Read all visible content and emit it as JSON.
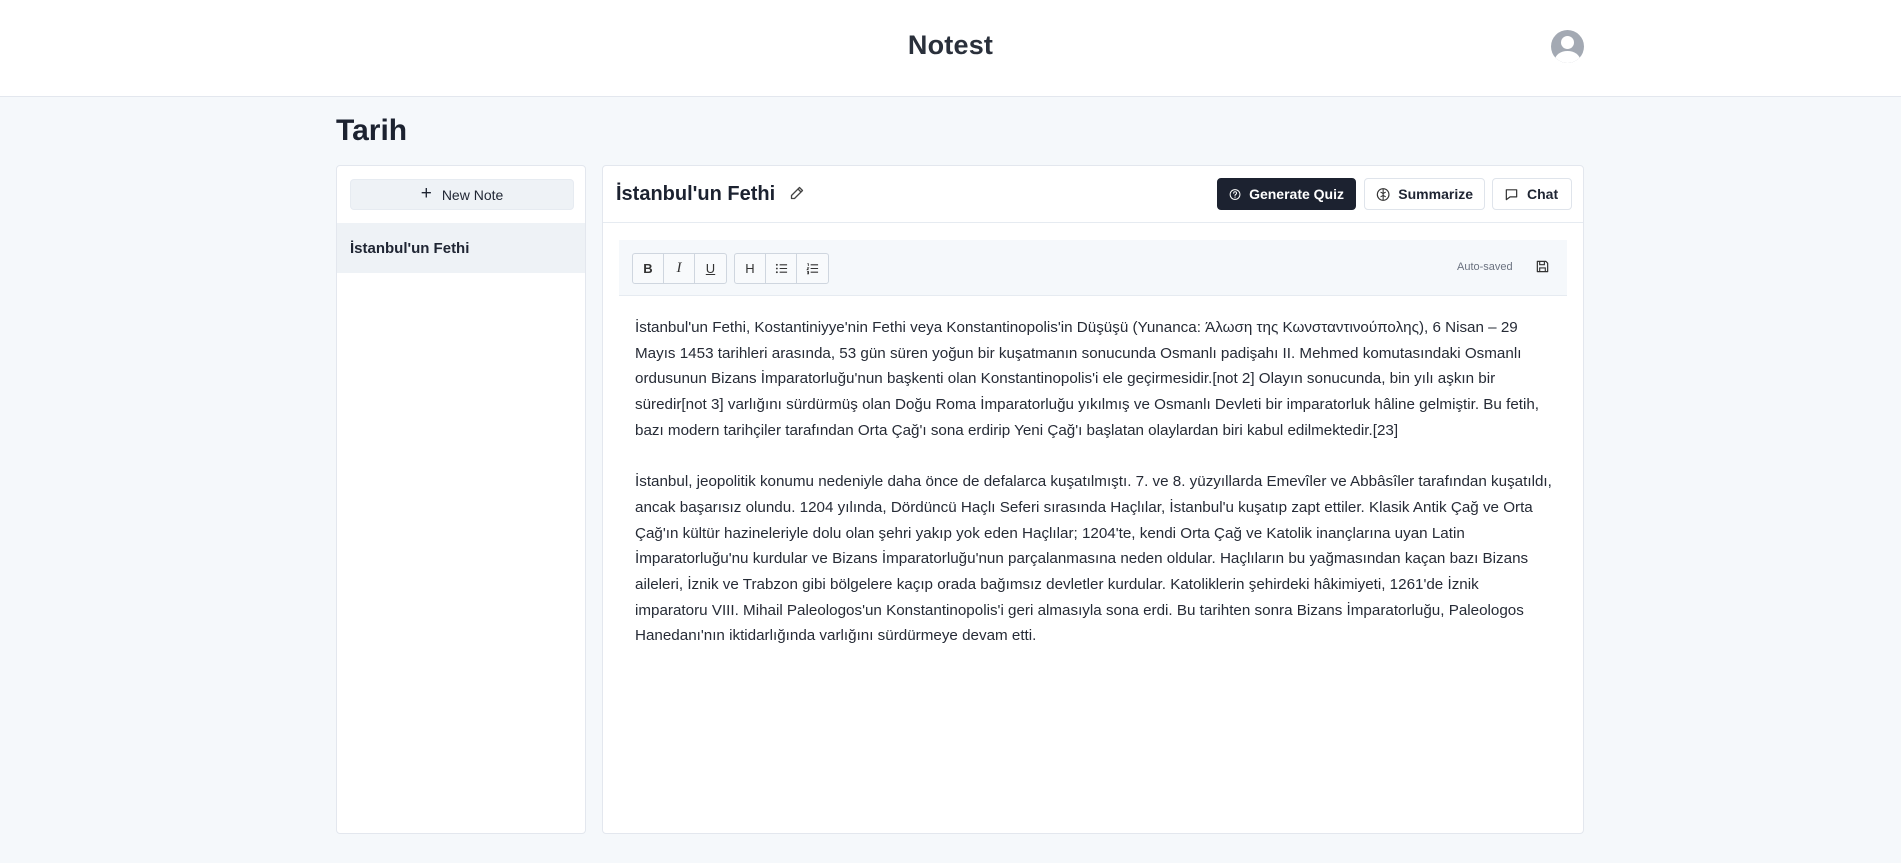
{
  "header": {
    "app_title": "Notest",
    "avatar_icon": "user-circle-icon"
  },
  "page": {
    "title": "Tarih"
  },
  "sidebar": {
    "new_note_label": "New Note",
    "new_note_icon": "plus-icon",
    "notes": [
      {
        "title": "İstanbul'un Fethi",
        "selected": true
      }
    ]
  },
  "note": {
    "title": "İstanbul'un Fethi",
    "actions": {
      "generate_quiz": "Generate Quiz",
      "summarize": "Summarize",
      "chat": "Chat"
    }
  },
  "editor": {
    "toolbar": {
      "bold": "B",
      "italic": "I",
      "underline": "U",
      "heading": "H",
      "bullet_list_icon": "bullet-list-icon",
      "numbered_list_icon": "numbered-list-icon"
    },
    "status": "Auto-saved",
    "paragraphs": [
      "İstanbul'un Fethi, Kostantiniyye'nin Fethi veya Konstantinopolis'in Düşüşü (Yunanca: Άλωση της Κωνσταντινούπολης), 6 Nisan – 29 Mayıs 1453 tarihleri arasında, 53 gün süren yoğun bir kuşatmanın sonucunda Osmanlı padişahı II. Mehmed komutasındaki Osmanlı ordusunun Bizans İmparatorluğu'nun başkenti olan Konstantinopolis'i ele geçirmesidir.[not 2] Olayın sonucunda, bin yılı aşkın bir süredir[not 3] varlığını sürdürmüş olan Doğu Roma İmparatorluğu yıkılmış ve Osmanlı Devleti bir imparatorluk hâline gelmiştir. Bu fetih, bazı modern tarihçiler tarafından Orta Çağ'ı sona erdirip Yeni Çağ'ı başlatan olaylardan biri kabul edilmektedir.[23]",
      "İstanbul, jeopolitik konumu nedeniyle daha önce de defalarca kuşatılmıştı. 7. ve 8. yüzyıllarda Emevîler ve Abbâsîler tarafından kuşatıldı, ancak başarısız olundu. 1204 yılında, Dördüncü Haçlı Seferi sırasında Haçlılar, İstanbul'u kuşatıp zapt ettiler. Klasik Antik Çağ ve Orta Çağ'ın kültür hazineleriyle dolu olan şehri yakıp yok eden Haçlılar; 1204'te, kendi Orta Çağ ve Katolik inançlarına uyan Latin İmparatorluğu'nu kurdular ve Bizans İmparatorluğu'nun parçalanmasına neden oldular. Haçlıların bu yağmasından kaçan bazı Bizans aileleri, İznik ve Trabzon gibi bölgelere kaçıp orada bağımsız devletler kurdular. Katoliklerin şehirdeki hâkimiyeti, 1261'de İznik imparatoru VIII. Mihail Paleologos'un Konstantinopolis'i geri almasıyla sona erdi. Bu tarihten sonra Bizans İmparatorluğu, Paleologos Hanedanı'nın iktidarlığında varlığını sürdürmeye devam etti."
    ]
  }
}
